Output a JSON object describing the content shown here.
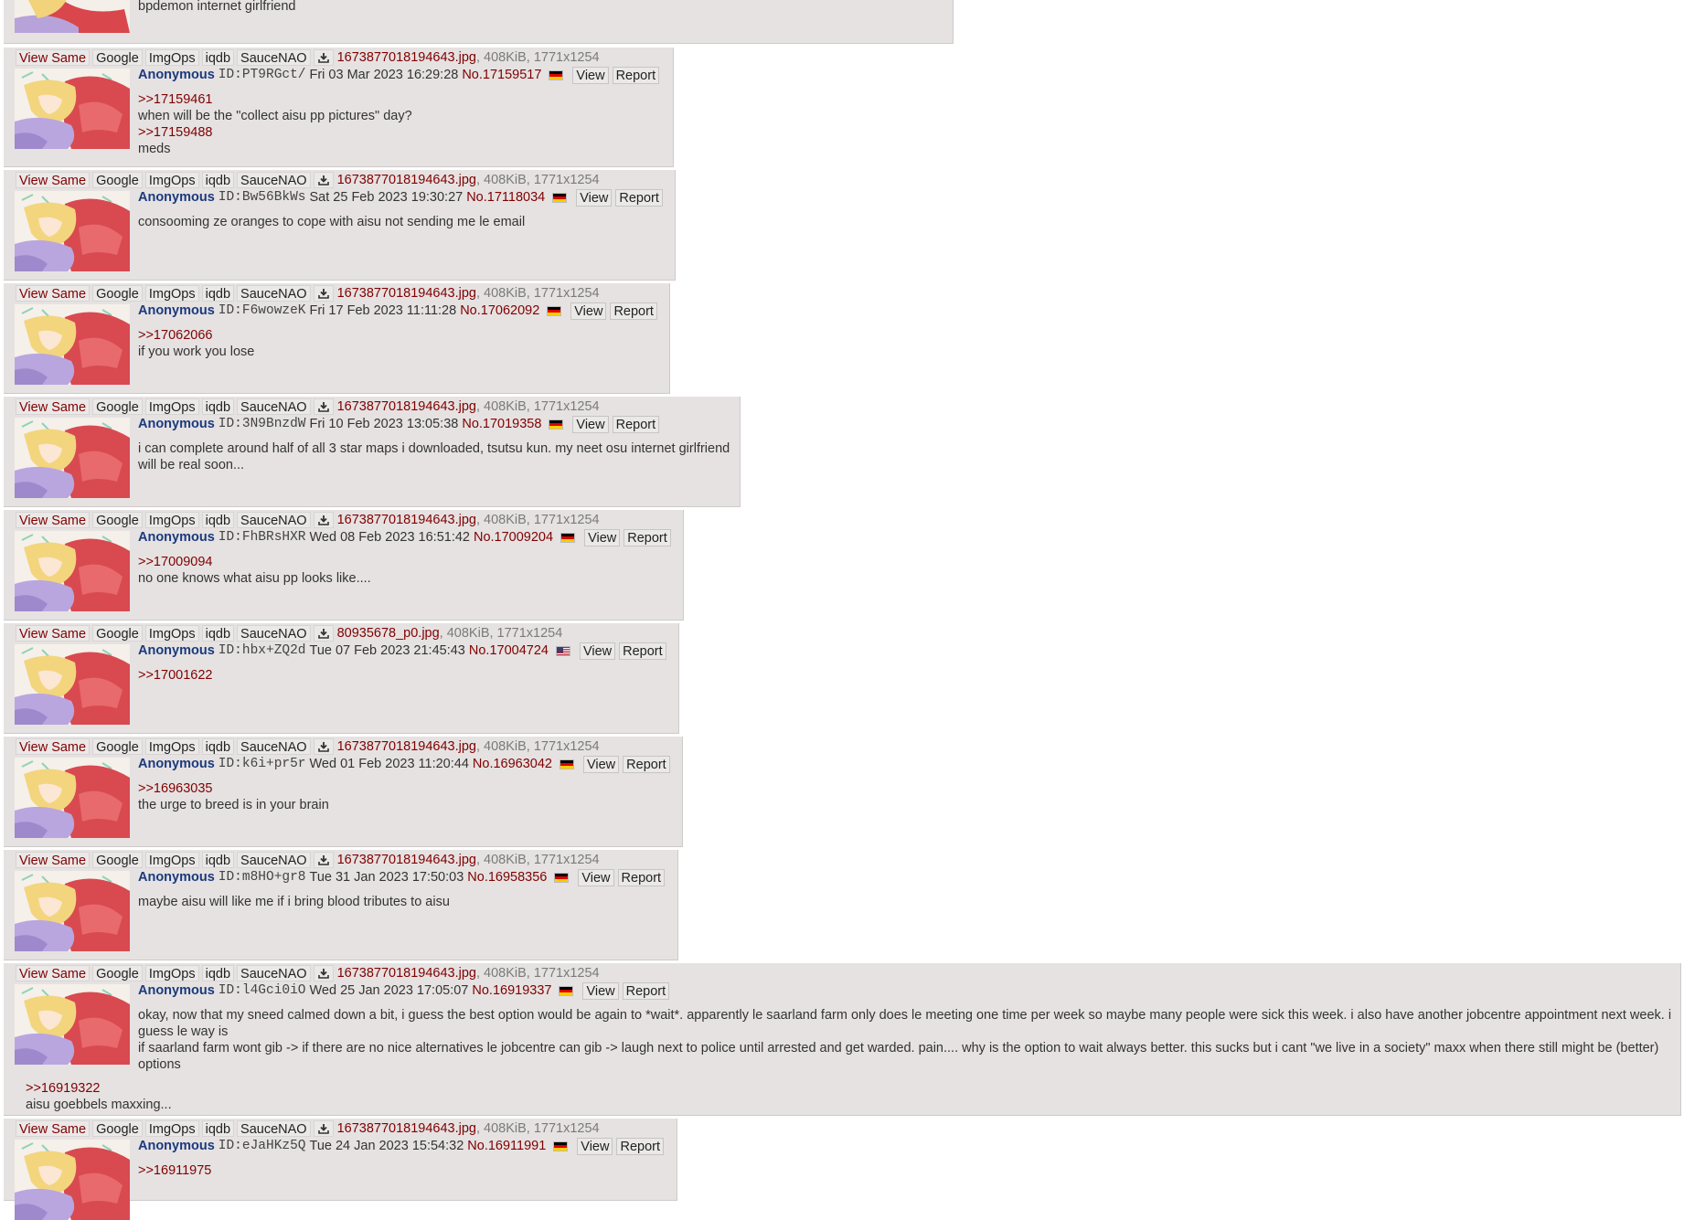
{
  "toolbar": {
    "view_same": "View Same",
    "google": "Google",
    "imgops": "ImgOps",
    "iqdb": "iqdb",
    "saucenao": "SauceNAO",
    "download_icon": "download-icon"
  },
  "buttons": {
    "view": "View",
    "report": "Report"
  },
  "posts": [
    {
      "partial_text": "bpdemon internet girlfriend"
    },
    {
      "filename": "1673877018194643.jpg",
      "meta": ", 408KiB, 1771x1254",
      "name": "Anonymous",
      "id": "ID:PT9RGct/",
      "date": "Fri 03 Mar 2023 16:29:28",
      "no": "No.17159517",
      "flag": "de",
      "lines": [
        ">>17159461",
        "when will be the \"collect aisu pp pictures\" day?",
        ">>17159488",
        "meds"
      ]
    },
    {
      "filename": "1673877018194643.jpg",
      "meta": ", 408KiB, 1771x1254",
      "name": "Anonymous",
      "id": "ID:Bw56BkWs",
      "date": "Sat 25 Feb 2023 19:30:27",
      "no": "No.17118034",
      "flag": "de",
      "lines": [
        "consooming ze oranges to cope with aisu not sending me le email"
      ]
    },
    {
      "filename": "1673877018194643.jpg",
      "meta": ", 408KiB, 1771x1254",
      "name": "Anonymous",
      "id": "ID:F6wowzeK",
      "date": "Fri 17 Feb 2023 11:11:28",
      "no": "No.17062092",
      "flag": "de",
      "lines": [
        ">>17062066",
        "if you work you lose"
      ]
    },
    {
      "filename": "1673877018194643.jpg",
      "meta": ", 408KiB, 1771x1254",
      "name": "Anonymous",
      "id": "ID:3N9BnzdW",
      "date": "Fri 10 Feb 2023 13:05:38",
      "no": "No.17019358",
      "flag": "de",
      "lines": [
        "i can complete around half of all 3 star maps i downloaded, tsutsu kun. my neet osu internet girlfriend will be real soon..."
      ]
    },
    {
      "filename": "1673877018194643.jpg",
      "meta": ", 408KiB, 1771x1254",
      "name": "Anonymous",
      "id": "ID:FhBRsHXR",
      "date": "Wed 08 Feb 2023 16:51:42",
      "no": "No.17009204",
      "flag": "de",
      "lines": [
        ">>17009094",
        "no one knows what aisu pp looks like...."
      ]
    },
    {
      "filename": "80935678_p0.jpg",
      "meta": ", 408KiB, 1771x1254",
      "name": "Anonymous",
      "id": "ID:hbx+ZQ2d",
      "date": "Tue 07 Feb 2023 21:45:43",
      "no": "No.17004724",
      "flag": "us",
      "lines": [
        ">>17001622"
      ]
    },
    {
      "filename": "1673877018194643.jpg",
      "meta": ", 408KiB, 1771x1254",
      "name": "Anonymous",
      "id": "ID:k6i+pr5r",
      "date": "Wed 01 Feb 2023 11:20:44",
      "no": "No.16963042",
      "flag": "de",
      "lines": [
        ">>16963035",
        "the urge to breed is in your brain"
      ]
    },
    {
      "filename": "1673877018194643.jpg",
      "meta": ", 408KiB, 1771x1254",
      "name": "Anonymous",
      "id": "ID:m8HO+gr8",
      "date": "Tue 31 Jan 2023 17:50:03",
      "no": "No.16958356",
      "flag": "de",
      "lines": [
        "maybe aisu will like me if i bring blood tributes to aisu"
      ]
    },
    {
      "filename": "1673877018194643.jpg",
      "meta": ", 408KiB, 1771x1254",
      "name": "Anonymous",
      "id": "ID:l4Gci0iO",
      "date": "Wed 25 Jan 2023 17:05:07",
      "no": "No.16919337",
      "flag": "de",
      "lines": [
        "okay, now that my sneed calmed down a bit, i guess the best option would be again to *wait*. apparently le saarland farm only does le meeting one time per week so maybe many people were sick this week. i also have another jobcentre appointment next week. i guess le way is",
        "if saarland farm wont gib -> if there are no nice alternatives le jobcentre can gib -> laugh next to police until arrested and get warded. pain.... why is the option to wait always better. this sucks but i cant \"we live in a society\" maxx when there still might be (better) options"
      ],
      "extra_lines": [
        ">>16919322",
        "aisu goebbels maxxing..."
      ]
    },
    {
      "filename": "1673877018194643.jpg",
      "meta": ", 408KiB, 1771x1254",
      "name": "Anonymous",
      "id": "ID:eJaHKz5Q",
      "date": "Tue 24 Jan 2023 15:54:32",
      "no": "No.16911991",
      "flag": "de",
      "lines": [
        ">>16911975"
      ]
    }
  ]
}
